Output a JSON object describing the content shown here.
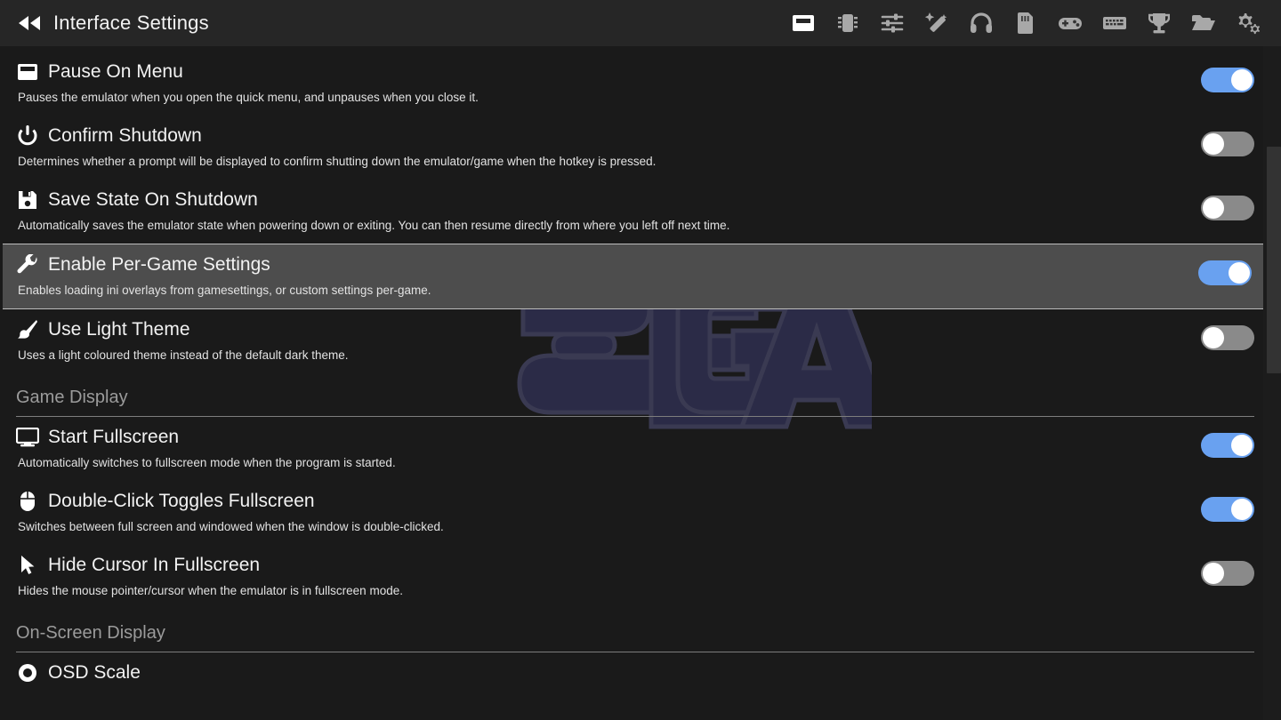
{
  "window": {
    "title": "Interface Settings",
    "back_icon": "rewind-icon",
    "background_color": "#1a1a1a",
    "topbar_color": "#262626"
  },
  "watermark": {
    "text": "SEGA",
    "registered_mark": "®",
    "color": "#2b2b47"
  },
  "toolbar": {
    "items": [
      {
        "name": "interface-settings-icon",
        "icon": "window",
        "label": "Interface",
        "active": true
      },
      {
        "name": "system-settings-icon",
        "icon": "chip",
        "label": "System",
        "active": false
      },
      {
        "name": "general-settings-icon",
        "icon": "sliders",
        "label": "General",
        "active": false
      },
      {
        "name": "enhancements-settings-icon",
        "icon": "magic-wand",
        "label": "Enhancements",
        "active": false
      },
      {
        "name": "audio-settings-icon",
        "icon": "headphones",
        "label": "Audio",
        "active": false
      },
      {
        "name": "memory-card-settings-icon",
        "icon": "memory-card",
        "label": "Memory Cards",
        "active": false
      },
      {
        "name": "controller-settings-icon",
        "icon": "gamepad",
        "label": "Controllers",
        "active": false
      },
      {
        "name": "hotkey-settings-icon",
        "icon": "keyboard",
        "label": "Hotkeys",
        "active": false
      },
      {
        "name": "achievements-settings-icon",
        "icon": "trophy",
        "label": "Achievements",
        "active": false
      },
      {
        "name": "folders-settings-icon",
        "icon": "folder",
        "label": "Folders",
        "active": false
      },
      {
        "name": "advanced-settings-icon",
        "icon": "gears",
        "label": "Advanced",
        "active": false
      }
    ]
  },
  "scrollbar": {
    "thumb_position_percent": 15,
    "thumb_size_percent": 34
  },
  "settings": [
    {
      "kind": "toggle",
      "icon": "window-pause",
      "title": "Pause On Menu",
      "description": "Pauses the emulator when you open the quick menu, and unpauses when you close it.",
      "value": true,
      "selected": false
    },
    {
      "kind": "toggle",
      "icon": "power",
      "title": "Confirm Shutdown",
      "description": "Determines whether a prompt will be displayed to confirm shutting down the emulator/game when the hotkey is pressed.",
      "value": false,
      "selected": false
    },
    {
      "kind": "toggle",
      "icon": "save-disk",
      "title": "Save State On Shutdown",
      "description": "Automatically saves the emulator state when powering down or exiting. You can then resume directly from where you left off next time.",
      "value": false,
      "selected": false
    },
    {
      "kind": "toggle",
      "icon": "wrench",
      "title": "Enable Per-Game Settings",
      "description": "Enables loading ini overlays from gamesettings, or custom settings per-game.",
      "value": true,
      "selected": true
    },
    {
      "kind": "toggle",
      "icon": "paintbrush",
      "title": "Use Light Theme",
      "description": "Uses a light coloured theme instead of the default dark theme.",
      "value": false,
      "selected": false
    },
    {
      "kind": "section",
      "title": "Game Display"
    },
    {
      "kind": "toggle",
      "icon": "monitor",
      "title": "Start Fullscreen",
      "description": "Automatically switches to fullscreen mode when the program is started.",
      "value": true,
      "selected": false
    },
    {
      "kind": "toggle",
      "icon": "mouse",
      "title": "Double-Click Toggles Fullscreen",
      "description": "Switches between full screen and windowed when the window is double-clicked.",
      "value": true,
      "selected": false
    },
    {
      "kind": "toggle",
      "icon": "cursor",
      "title": "Hide Cursor In Fullscreen",
      "description": "Hides the mouse pointer/cursor when the emulator is in fullscreen mode.",
      "value": false,
      "selected": false
    },
    {
      "kind": "section",
      "title": "On-Screen Display"
    },
    {
      "kind": "partial",
      "icon": "osd",
      "title": "OSD Scale",
      "description": "",
      "value": null,
      "selected": false
    }
  ]
}
